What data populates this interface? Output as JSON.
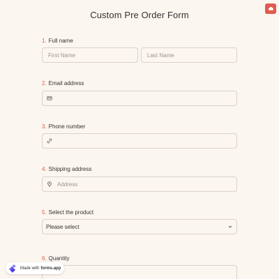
{
  "form": {
    "title": "Custom Pre Order Form"
  },
  "questions": [
    {
      "number": "1.",
      "label": "Full name",
      "first_placeholder": "First Name",
      "last_placeholder": "Last Name"
    },
    {
      "number": "2.",
      "label": "Email address"
    },
    {
      "number": "3.",
      "label": "Phone number"
    },
    {
      "number": "4.",
      "label": "Shipping address",
      "placeholder": "Address"
    },
    {
      "number": "5.",
      "label": "Select the product",
      "selected": "Please select"
    },
    {
      "number": "6.",
      "label": "Quantity"
    }
  ],
  "badge": {
    "prefix": "Made with",
    "brand": "forms.app"
  },
  "colors": {
    "accent": "#e05a4f",
    "background": "#fbf6ef",
    "border": "#d8d2c9"
  },
  "icons": [
    "cloud-icon",
    "mail-icon",
    "link-icon",
    "location-pin-icon",
    "chevron-down-icon",
    "forms-app-logo-icon"
  ]
}
